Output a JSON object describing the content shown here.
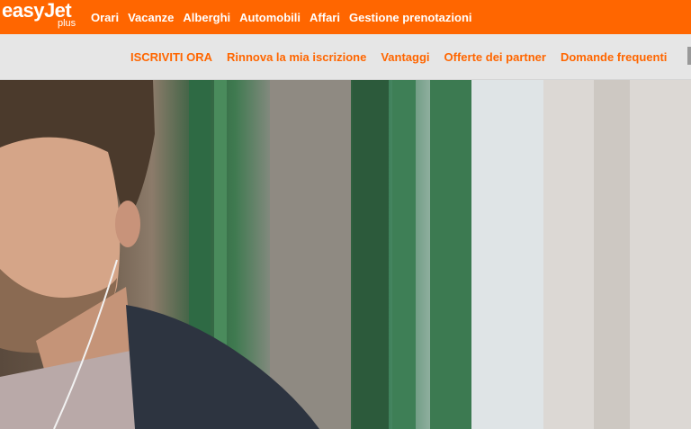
{
  "brand": {
    "name": "easyJet",
    "sub": "plus",
    "color": "#ff6600"
  },
  "main_nav": [
    {
      "label": "Orari"
    },
    {
      "label": "Vacanze"
    },
    {
      "label": "Alberghi"
    },
    {
      "label": "Automobili"
    },
    {
      "label": "Affari"
    },
    {
      "label": "Gestione prenotazioni"
    }
  ],
  "sub_nav": [
    {
      "label": "ISCRIVITI ORA"
    },
    {
      "label": "Rinnova la mia iscrizione"
    },
    {
      "label": "Vantaggi"
    },
    {
      "label": "Offerte dei partner"
    },
    {
      "label": "Domande frequenti"
    }
  ],
  "colors": {
    "header": "#ff6600",
    "subbar": "#e6e6e6",
    "subnav_text": "#ff6600"
  }
}
